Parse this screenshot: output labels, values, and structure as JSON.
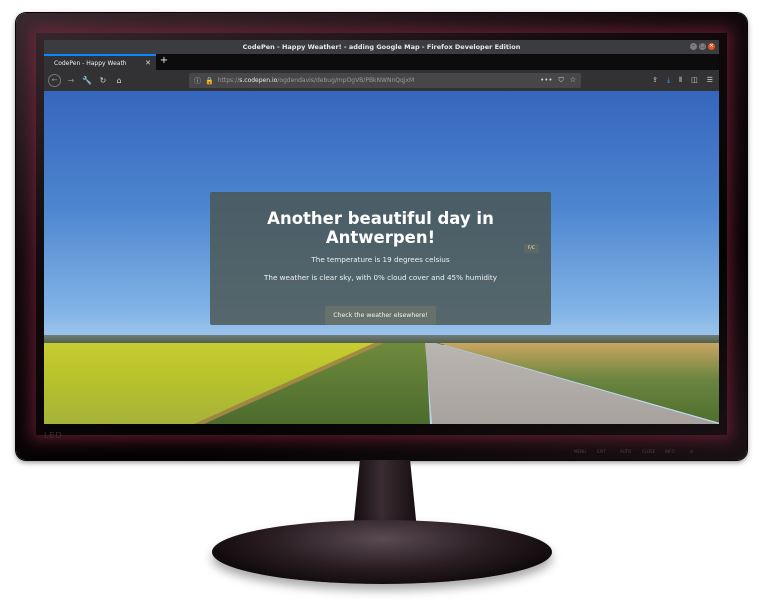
{
  "monitor": {
    "brand": "LED",
    "buttons": [
      "MENU",
      "EXIT",
      "AUTO",
      "CLOSE",
      "INFO",
      "⏻"
    ]
  },
  "browser": {
    "window_title": "CodePen - Happy Weather! - adding Google Map - Firefox Developer Edition",
    "tab_title": "CodePen - Happy Weath",
    "url_host": "s.codepen.io",
    "url_prefix": "https://",
    "url_path": "/ogdendavis/debug/mpOgVB/PBkNWNnQqjxM"
  },
  "page": {
    "heading": "Another beautiful day in Antwerpen!",
    "temperature_line": "The temperature is 19 degrees celsius",
    "weather_line": "The weather is clear sky, with 0% cloud cover and 45% humidity",
    "unit_toggle": "F/C",
    "check_button": "Check the weather elsewhere!"
  }
}
